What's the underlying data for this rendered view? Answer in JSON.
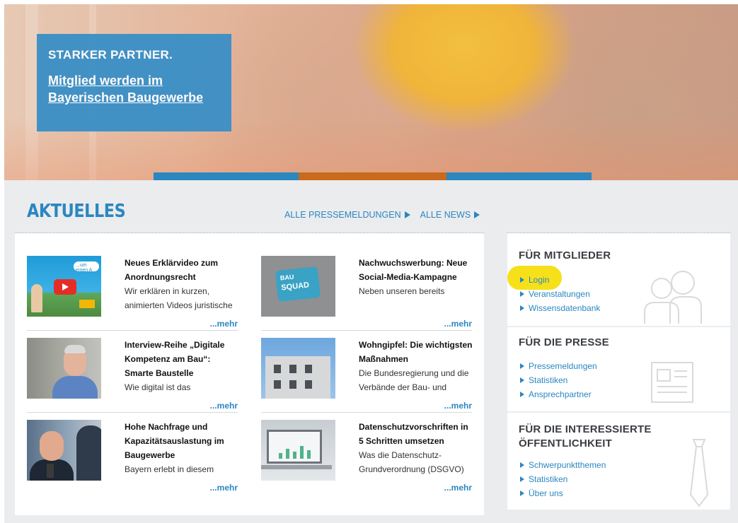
{
  "hero": {
    "kicker": "STARKER PARTNER.",
    "link_line1": "Mitglied werden im",
    "link_line2": "Bayerischen Baugewerbe"
  },
  "aktuelles": {
    "title": "AKTUELLES",
    "link_press": "ALLE PRESSEMELDUNGEN",
    "link_news": "ALLE NEWS"
  },
  "news": [
    {
      "headline": "Neues Erklärvideo zum Anordnungsrecht",
      "teaser": "Wir erklären in kurzen, animierten Videos juristische",
      "more": "...mehr",
      "thumb": "video-thumbnail"
    },
    {
      "headline": "Nachwuchswerbung: Neue Social-Media-Kampagne",
      "teaser": "Neben unseren bereits",
      "more": "...mehr",
      "thumb": "bau-squad-sticker"
    },
    {
      "headline": "Interview-Reihe „Digitale Kompetenz am Bau“: Smarte Baustelle",
      "teaser": "Wie digital ist das",
      "more": "...mehr",
      "thumb": "portrait-photo"
    },
    {
      "headline": "Wohngipfel: Die wichtigsten Maßnahmen",
      "teaser": "Die Bundesregierung und die Verbände der Bau- und",
      "more": "...mehr",
      "thumb": "building-photo"
    },
    {
      "headline": "Hohe Nachfrage und Kapazitätsauslastung im Baugewerbe",
      "teaser": "Bayern erlebt in diesem",
      "more": "...mehr",
      "thumb": "interview-photo"
    },
    {
      "headline": "Datenschutzvorschriften in 5 Schritten umsetzen",
      "teaser": "Was die Datenschutz-Grundverordnung (DSGVO)",
      "more": "...mehr",
      "thumb": "laptop-photo"
    }
  ],
  "thumb_text": {
    "squad_top": "BAU",
    "squad_bottom": "SQUAD",
    "video_bubble": "...um einen A"
  },
  "sidebar": {
    "members": {
      "title": "FÜR MITGLIEDER",
      "items": [
        "Login",
        "Veranstaltungen",
        "Wissensdatenbank"
      ],
      "icon": "people-icon"
    },
    "press": {
      "title": "FÜR DIE PRESSE",
      "items": [
        "Pressemeldungen",
        "Statistiken",
        "Ansprechpartner"
      ],
      "icon": "newspaper-icon"
    },
    "public": {
      "title_line1": "FÜR DIE INTERESSIERTE",
      "title_line2": "ÖFFENTLICHKEIT",
      "items": [
        "Schwerpunktthemen",
        "Statistiken",
        "Über uns"
      ],
      "icon": "tie-icon"
    }
  },
  "colors": {
    "brand_blue": "#2a87c0",
    "accent_orange": "#c96a1c",
    "highlight_yellow": "#f6e01a"
  }
}
